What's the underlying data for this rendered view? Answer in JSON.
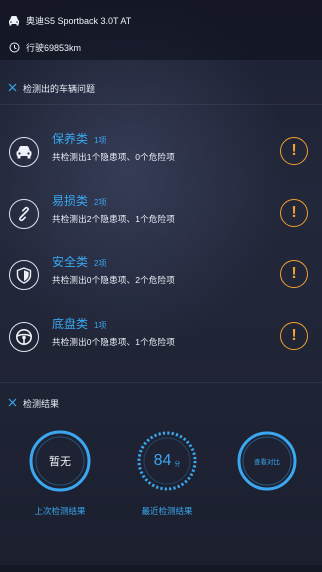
{
  "header": {
    "car_model": "奥迪S5 Sportback 3.0T AT",
    "mileage": "行驶69853km"
  },
  "problems_section": {
    "title": "检测出的车辆问题",
    "items": [
      {
        "name": "保养类",
        "count": "1项",
        "desc": "共检测出1个隐患项、0个危险项",
        "icon": "car-icon"
      },
      {
        "name": "易损类",
        "count": "2项",
        "desc": "共检测出2个隐患项、1个危险项",
        "icon": "chain-link-icon"
      },
      {
        "name": "安全类",
        "count": "2项",
        "desc": "共检测出0个隐患项、2个危险项",
        "icon": "shield-icon"
      },
      {
        "name": "底盘类",
        "count": "1项",
        "desc": "共检测出0个隐患项、1个危险项",
        "icon": "steering-wheel-icon"
      }
    ],
    "warning_symbol": "!"
  },
  "results_section": {
    "title": "检测结果",
    "previous": {
      "value": "暂无",
      "label": "上次检测结果"
    },
    "recent": {
      "score": "84",
      "unit": "分",
      "label": "最近检测结果"
    },
    "compare": {
      "label": "查看对比"
    }
  },
  "colors": {
    "accent": "#3aa7f0",
    "warning": "#f0a030",
    "background": "#1f2435"
  }
}
